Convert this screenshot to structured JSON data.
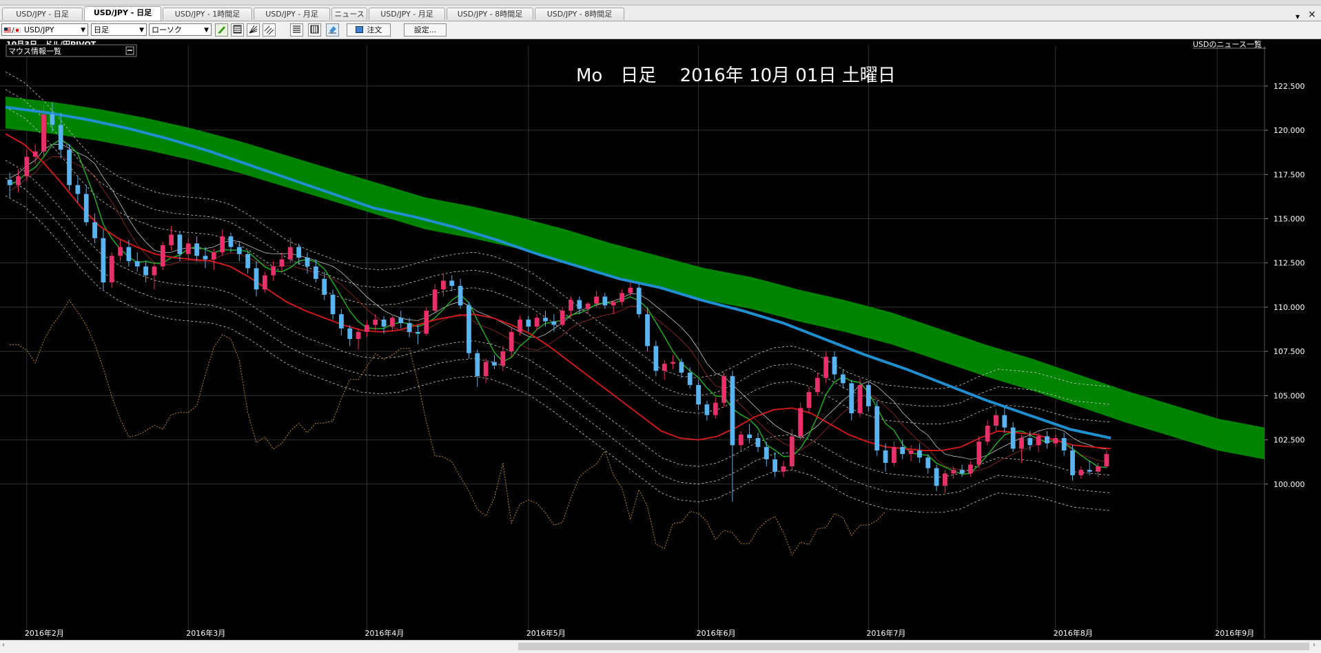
{
  "tabs": [
    {
      "label": "USD/JPY - 日足",
      "active": false
    },
    {
      "label": "USD/JPY - 日足",
      "active": true
    },
    {
      "label": "USD/JPY - 1時間足",
      "active": false
    },
    {
      "label": "USD/JPY - 月足",
      "active": false
    },
    {
      "label": "ニュース",
      "active": false
    },
    {
      "label": "USD/JPY - 月足",
      "active": false
    },
    {
      "label": "USD/JPY - 8時間足",
      "active": false
    },
    {
      "label": "USD/JPY - 8時間足",
      "active": false
    }
  ],
  "window_controls": {
    "dropdown": "▾",
    "close": "×"
  },
  "toolbar": {
    "symbol": "USD/JPY",
    "timeframe": "日足",
    "chart_type": "ローソク",
    "order_label": "注文",
    "settings_label": "設定..."
  },
  "chart_header": {
    "news_ticker": "10月3日、ドル/円PIVOT",
    "news_link": "USDのニュース一覧",
    "mouse_panel": "マウス情報一覧",
    "overlay_title": "Mo　日足　 2016年 10月 01日 土曜日"
  },
  "colors": {
    "background": "#000000",
    "up_candle": "#e8306a",
    "down_candle": "#5ab4f0",
    "cloud": "#008a00",
    "ma_long": "#1f8fd0",
    "ma_mid": "#cc1a1a",
    "ma_short": "#22aa22",
    "bands": "#cfcfcf",
    "chikou": "#c08a20"
  },
  "chart_data": {
    "type": "candlestick",
    "y_ticks": [
      "122.500",
      "120.000",
      "117.500",
      "115.000",
      "112.500",
      "110.000",
      "107.500",
      "105.000",
      "102.500",
      "100.000"
    ],
    "x_ticks": [
      "2016年2月",
      "2016年3月",
      "2016年4月",
      "2016年5月",
      "2016年6月",
      "2016年7月",
      "2016年8月",
      "2016年9月"
    ],
    "ylim": [
      98.0,
      123.0
    ],
    "candles": [
      [
        117.2,
        117.6,
        116.2,
        116.9
      ],
      [
        116.9,
        117.8,
        116.5,
        117.4
      ],
      [
        117.4,
        118.9,
        117.1,
        118.5
      ],
      [
        118.5,
        119.2,
        118.1,
        118.8
      ],
      [
        118.8,
        121.4,
        118.5,
        120.9
      ],
      [
        120.9,
        121.6,
        119.9,
        120.3
      ],
      [
        120.3,
        121.0,
        118.4,
        118.9
      ],
      [
        118.9,
        119.2,
        116.6,
        116.9
      ],
      [
        116.9,
        117.4,
        115.9,
        116.4
      ],
      [
        116.4,
        116.9,
        114.6,
        114.8
      ],
      [
        114.8,
        115.3,
        113.6,
        113.9
      ],
      [
        113.9,
        114.4,
        111.0,
        111.4
      ],
      [
        111.4,
        113.1,
        111.1,
        112.9
      ],
      [
        112.9,
        113.8,
        112.6,
        113.4
      ],
      [
        113.4,
        113.8,
        112.3,
        112.6
      ],
      [
        112.6,
        113.1,
        112.0,
        112.3
      ],
      [
        112.3,
        112.6,
        111.4,
        111.8
      ],
      [
        111.8,
        112.5,
        111.0,
        112.3
      ],
      [
        112.3,
        113.7,
        112.1,
        113.5
      ],
      [
        113.5,
        114.6,
        113.2,
        114.1
      ],
      [
        114.1,
        114.3,
        112.6,
        113.0
      ],
      [
        113.0,
        113.9,
        112.7,
        113.6
      ],
      [
        113.6,
        114.0,
        112.6,
        112.9
      ],
      [
        112.9,
        113.4,
        112.2,
        112.7
      ],
      [
        112.7,
        113.3,
        112.1,
        113.1
      ],
      [
        113.1,
        114.4,
        112.9,
        114.0
      ],
      [
        114.0,
        114.2,
        113.1,
        113.4
      ],
      [
        113.4,
        113.7,
        112.6,
        113.0
      ],
      [
        113.0,
        113.2,
        111.9,
        112.2
      ],
      [
        112.2,
        112.6,
        110.6,
        111.0
      ],
      [
        111.0,
        112.0,
        110.8,
        111.8
      ],
      [
        111.8,
        112.6,
        111.5,
        112.3
      ],
      [
        112.3,
        113.1,
        112.0,
        112.7
      ],
      [
        112.7,
        113.9,
        112.5,
        113.4
      ],
      [
        113.4,
        113.6,
        112.4,
        112.8
      ],
      [
        112.8,
        113.1,
        111.9,
        112.3
      ],
      [
        112.3,
        112.7,
        111.4,
        111.6
      ],
      [
        111.6,
        112.0,
        110.4,
        110.7
      ],
      [
        110.7,
        111.0,
        109.3,
        109.6
      ],
      [
        109.6,
        109.9,
        108.4,
        108.8
      ],
      [
        108.8,
        109.0,
        107.8,
        108.2
      ],
      [
        108.2,
        108.8,
        107.6,
        108.6
      ],
      [
        108.6,
        109.2,
        108.3,
        109.0
      ],
      [
        109.0,
        109.6,
        108.7,
        109.3
      ],
      [
        109.3,
        109.5,
        108.5,
        108.9
      ],
      [
        108.9,
        109.5,
        108.6,
        109.4
      ],
      [
        109.4,
        109.8,
        108.8,
        109.1
      ],
      [
        109.1,
        109.4,
        108.3,
        108.6
      ],
      [
        108.6,
        109.0,
        107.9,
        108.5
      ],
      [
        108.5,
        110.0,
        108.4,
        109.8
      ],
      [
        109.8,
        111.3,
        109.7,
        111.0
      ],
      [
        111.0,
        111.9,
        110.6,
        111.5
      ],
      [
        111.5,
        111.8,
        110.9,
        111.2
      ],
      [
        111.2,
        111.6,
        109.9,
        110.1
      ],
      [
        110.1,
        110.3,
        107.1,
        107.4
      ],
      [
        107.4,
        107.6,
        105.5,
        106.1
      ],
      [
        106.1,
        107.1,
        105.7,
        106.9
      ],
      [
        106.9,
        107.3,
        106.5,
        106.7
      ],
      [
        106.7,
        107.8,
        106.4,
        107.5
      ],
      [
        107.5,
        108.9,
        107.2,
        108.6
      ],
      [
        108.6,
        109.5,
        108.4,
        109.3
      ],
      [
        109.3,
        109.5,
        108.6,
        108.9
      ],
      [
        108.9,
        109.6,
        108.7,
        109.4
      ],
      [
        109.4,
        109.8,
        108.9,
        109.2
      ],
      [
        109.2,
        109.6,
        108.6,
        109.0
      ],
      [
        109.0,
        110.0,
        108.9,
        109.8
      ],
      [
        109.8,
        110.6,
        109.5,
        110.4
      ],
      [
        110.4,
        110.6,
        109.6,
        109.9
      ],
      [
        109.9,
        110.3,
        109.6,
        110.2
      ],
      [
        110.2,
        110.9,
        110.0,
        110.6
      ],
      [
        110.6,
        110.8,
        109.9,
        110.1
      ],
      [
        110.1,
        110.4,
        109.6,
        110.3
      ],
      [
        110.3,
        111.0,
        110.1,
        110.8
      ],
      [
        110.8,
        111.4,
        110.6,
        111.1
      ],
      [
        111.1,
        111.3,
        109.4,
        109.6
      ],
      [
        109.6,
        110.0,
        107.5,
        107.8
      ],
      [
        107.8,
        108.1,
        106.1,
        106.4
      ],
      [
        106.4,
        107.0,
        105.9,
        106.8
      ],
      [
        106.8,
        107.3,
        106.5,
        106.9
      ],
      [
        106.9,
        107.1,
        106.0,
        106.3
      ],
      [
        106.3,
        106.6,
        105.4,
        105.6
      ],
      [
        105.6,
        105.9,
        104.2,
        104.5
      ],
      [
        104.5,
        104.7,
        103.6,
        103.9
      ],
      [
        103.9,
        104.9,
        103.7,
        104.6
      ],
      [
        104.6,
        106.3,
        104.4,
        106.1
      ],
      [
        106.1,
        106.4,
        99.0,
        102.2
      ],
      [
        102.2,
        103.0,
        101.9,
        102.8
      ],
      [
        102.8,
        103.4,
        102.3,
        102.6
      ],
      [
        102.6,
        102.9,
        101.8,
        102.1
      ],
      [
        102.1,
        102.4,
        101.0,
        101.4
      ],
      [
        101.4,
        101.8,
        100.4,
        100.7
      ],
      [
        100.7,
        101.3,
        100.4,
        101.0
      ],
      [
        101.0,
        103.1,
        100.8,
        102.7
      ],
      [
        102.7,
        104.6,
        102.5,
        104.3
      ],
      [
        104.3,
        105.5,
        104.0,
        105.2
      ],
      [
        105.2,
        106.3,
        105.0,
        106.0
      ],
      [
        106.0,
        107.5,
        105.7,
        107.2
      ],
      [
        107.2,
        107.5,
        105.9,
        106.2
      ],
      [
        106.2,
        106.5,
        105.4,
        105.7
      ],
      [
        105.7,
        105.9,
        103.6,
        104.0
      ],
      [
        104.0,
        106.0,
        103.8,
        105.6
      ],
      [
        105.6,
        105.8,
        104.1,
        104.4
      ],
      [
        104.4,
        104.7,
        101.6,
        101.9
      ],
      [
        101.9,
        102.3,
        100.7,
        101.2
      ],
      [
        101.2,
        102.4,
        101.0,
        102.1
      ],
      [
        102.1,
        102.5,
        101.4,
        101.7
      ],
      [
        101.7,
        102.2,
        101.3,
        101.9
      ],
      [
        101.9,
        102.3,
        101.2,
        101.5
      ],
      [
        101.5,
        101.7,
        100.6,
        100.9
      ],
      [
        100.9,
        101.1,
        99.6,
        99.9
      ],
      [
        99.9,
        100.8,
        99.5,
        100.6
      ],
      [
        100.6,
        101.0,
        100.3,
        100.8
      ],
      [
        100.8,
        101.1,
        100.4,
        100.6
      ],
      [
        100.6,
        101.3,
        100.4,
        101.1
      ],
      [
        101.1,
        102.7,
        100.9,
        102.4
      ],
      [
        102.4,
        103.6,
        102.2,
        103.3
      ],
      [
        103.3,
        104.2,
        103.0,
        103.9
      ],
      [
        103.9,
        104.3,
        102.9,
        103.2
      ],
      [
        103.2,
        103.5,
        101.8,
        102.0
      ],
      [
        102.0,
        102.8,
        101.2,
        102.6
      ],
      [
        102.6,
        103.0,
        101.9,
        102.2
      ],
      [
        102.2,
        102.9,
        101.8,
        102.7
      ],
      [
        102.7,
        103.0,
        102.0,
        102.3
      ],
      [
        102.3,
        102.8,
        102.1,
        102.6
      ],
      [
        102.6,
        102.9,
        101.6,
        101.9
      ],
      [
        101.9,
        102.2,
        100.2,
        100.5
      ],
      [
        100.5,
        101.0,
        100.3,
        100.8
      ],
      [
        100.8,
        101.3,
        100.5,
        100.7
      ],
      [
        100.7,
        101.2,
        100.4,
        101.0
      ],
      [
        101.0,
        101.9,
        100.9,
        101.7
      ]
    ],
    "ma_long": [
      121.3,
      121.0,
      120.6,
      120.1,
      119.5,
      118.8,
      118.0,
      117.2,
      116.4,
      115.6,
      115.1,
      114.5,
      113.8,
      113.0,
      112.3,
      111.6,
      111.1,
      110.4,
      109.8,
      109.1,
      108.2,
      107.3,
      106.5,
      105.6,
      104.7,
      103.9,
      103.1,
      102.6
    ],
    "ma_mid": [
      119.8,
      119.2,
      118.2,
      117.0,
      115.7,
      114.6,
      113.9,
      113.4,
      113.0,
      112.8,
      112.7,
      112.6,
      112.3,
      111.7,
      111.0,
      110.3,
      109.8,
      109.4,
      109.0,
      108.7,
      108.6,
      108.7,
      109.0,
      109.3,
      109.5,
      109.6,
      109.4,
      109.0,
      108.5,
      107.8,
      107.0,
      106.2,
      105.4,
      104.6,
      103.8,
      103.0,
      102.6,
      102.5,
      102.7,
      103.2,
      103.8,
      104.2,
      104.3,
      104.0,
      103.4,
      102.8,
      102.4,
      102.1,
      102.0,
      101.9,
      101.9,
      102.1,
      102.6,
      103.0,
      102.9,
      102.8,
      102.5,
      102.2,
      102.1,
      102.0
    ]
  }
}
